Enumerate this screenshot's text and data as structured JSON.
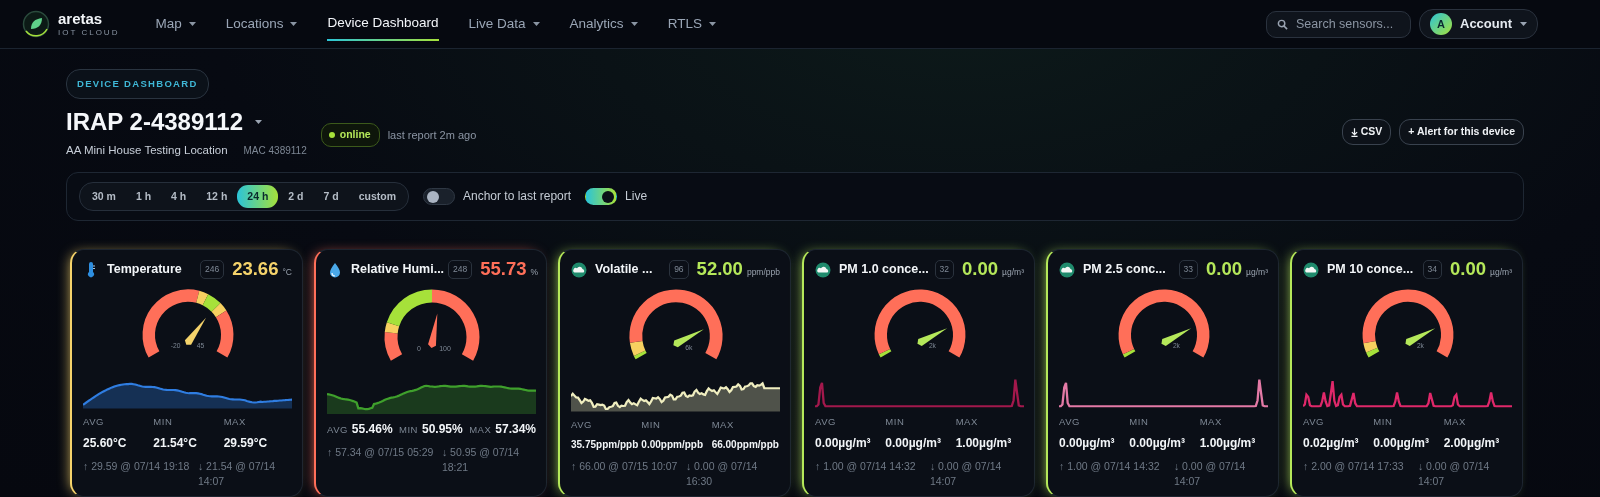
{
  "brand": {
    "name": "aretas",
    "tagline": "IOT CLOUD"
  },
  "nav": [
    {
      "label": "Map",
      "dropdown": true,
      "selected": false
    },
    {
      "label": "Locations",
      "dropdown": true,
      "selected": false
    },
    {
      "label": "Device Dashboard",
      "dropdown": false,
      "selected": true
    },
    {
      "label": "Live Data",
      "dropdown": true,
      "selected": false
    },
    {
      "label": "Analytics",
      "dropdown": true,
      "selected": false
    },
    {
      "label": "RTLS",
      "dropdown": true,
      "selected": false
    }
  ],
  "search": {
    "placeholder": "Search sensors..."
  },
  "account": {
    "avatar": "A",
    "label": "Account"
  },
  "header": {
    "badge": "DEVICE DASHBOARD",
    "title": "IRAP 2-4389112",
    "location": "AA Mini House Testing Location",
    "mac": "MAC 4389112",
    "status": {
      "label": "online",
      "online": true
    },
    "last_report": "last report 2m ago",
    "buttons": [
      {
        "label": "CSV",
        "kind": "download"
      },
      {
        "label": "+ Alert for this device",
        "kind": "plain"
      }
    ]
  },
  "ranges": [
    {
      "label": "30 m",
      "selected": false
    },
    {
      "label": "1 h",
      "selected": false
    },
    {
      "label": "4 h",
      "selected": false
    },
    {
      "label": "12 h",
      "selected": false
    },
    {
      "label": "24 h",
      "selected": true
    },
    {
      "label": "2 d",
      "selected": false
    },
    {
      "label": "7 d",
      "selected": false
    },
    {
      "label": "custom",
      "selected": false
    }
  ],
  "toggles": [
    {
      "label": "Anchor to last report",
      "on": false
    },
    {
      "label": "Live",
      "on": true
    }
  ],
  "cards": [
    {
      "kind": "temperature",
      "title": "Temperature",
      "count": "246",
      "value": "23.66",
      "unit": "°C",
      "color": "#f5d36b",
      "gauge": {
        "min_label": "-20",
        "max_label": "45"
      },
      "spark": {
        "kind": "hump",
        "color": "#2f7de1"
      },
      "stats": [
        {
          "label": "AVG",
          "value": "25.60°C"
        },
        {
          "label": "MIN",
          "value": "21.54°C"
        },
        {
          "label": "MAX",
          "value": "29.59°C"
        }
      ],
      "high": "↑ 29.59 @ 07/14 19:18",
      "low": "↓ 21.54 @ 07/14 14:07"
    },
    {
      "kind": "humidity",
      "title": "Relative Humi...",
      "count": "248",
      "value": "55.73",
      "unit": "%",
      "color": "#ff6f59",
      "gauge": {
        "min_label": "0",
        "max_label": "100"
      },
      "spark": {
        "kind": "plateau",
        "color": "#3fa02c"
      },
      "stats": [
        {
          "label": "AVG",
          "value": "55.46%"
        },
        {
          "label": "MIN",
          "value": "50.95%"
        },
        {
          "label": "MAX",
          "value": "57.34%"
        }
      ],
      "high": "↑ 57.34 @ 07/15 05:29",
      "low": "↓ 50.95 @ 07/14 18:21"
    },
    {
      "kind": "air",
      "title": "Volatile ...",
      "count": "96",
      "value": "52.00",
      "unit": "ppm/ppb",
      "color": "#b5e85a",
      "gauge": {
        "max_label": "6k"
      },
      "spark": {
        "kind": "noisy",
        "color": "#f0eec0"
      },
      "stats": [
        {
          "label": "AVG",
          "value": "35.75ppm/ppb"
        },
        {
          "label": "MIN",
          "value": "0.00ppm/ppb"
        },
        {
          "label": "MAX",
          "value": "66.00ppm/ppb"
        }
      ],
      "high": "↑ 66.00 @ 07/15 10:07",
      "low": "↓ 0.00 @ 07/14 16:30"
    },
    {
      "kind": "air",
      "title": "PM 1.0 conce...",
      "count": "32",
      "value": "0.00",
      "unit": "µg/m³",
      "color": "#b5e85a",
      "gauge": {
        "max_label": "2k"
      },
      "spark": {
        "kind": "two-spikes",
        "color": "#a3184c"
      },
      "stats": [
        {
          "label": "AVG",
          "value": "0.00µg/m³"
        },
        {
          "label": "MIN",
          "value": "0.00µg/m³"
        },
        {
          "label": "MAX",
          "value": "1.00µg/m³"
        }
      ],
      "high": "↑ 1.00 @ 07/14 14:32",
      "low": "↓ 0.00 @ 07/14 14:07"
    },
    {
      "kind": "air",
      "title": "PM 2.5 conc...",
      "count": "33",
      "value": "0.00",
      "unit": "µg/m³",
      "color": "#b5e85a",
      "gauge": {
        "max_label": "2k"
      },
      "spark": {
        "kind": "two-spikes",
        "color": "#e47aa6"
      },
      "stats": [
        {
          "label": "AVG",
          "value": "0.00µg/m³"
        },
        {
          "label": "MIN",
          "value": "0.00µg/m³"
        },
        {
          "label": "MAX",
          "value": "1.00µg/m³"
        }
      ],
      "high": "↑ 1.00 @ 07/14 14:32",
      "low": "↓ 0.00 @ 07/14 14:07"
    },
    {
      "kind": "air",
      "title": "PM 10 conce...",
      "count": "34",
      "value": "0.00",
      "unit": "µg/m³",
      "color": "#b5e85a",
      "gauge": {
        "max_label": "2k"
      },
      "spark": {
        "kind": "many-spikes",
        "color": "#e0286a"
      },
      "stats": [
        {
          "label": "AVG",
          "value": "0.02µg/m³"
        },
        {
          "label": "MIN",
          "value": "0.00µg/m³"
        },
        {
          "label": "MAX",
          "value": "2.00µg/m³"
        }
      ],
      "high": "↑ 2.00 @ 07/14 17:33",
      "low": "↓ 0.00 @ 07/14 14:07"
    }
  ]
}
